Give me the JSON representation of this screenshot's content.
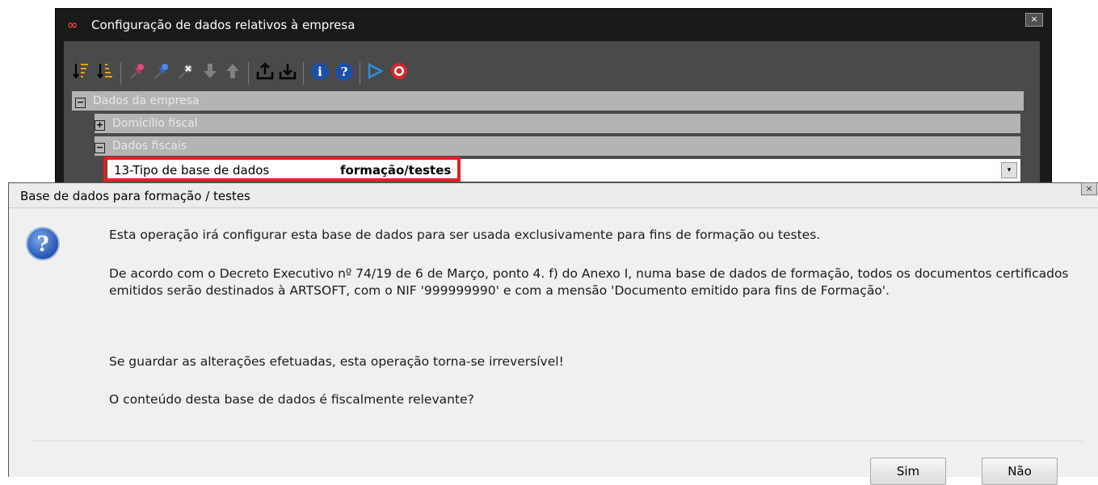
{
  "main_window": {
    "title": "Configuração de dados relativos à empresa",
    "close": "×",
    "tree": {
      "root": {
        "toggle": "−",
        "label": "Dados da empresa"
      },
      "child1": {
        "toggle": "+",
        "label": "Domicílio fiscal"
      },
      "child2": {
        "toggle": "−",
        "label": "Dados fiscais"
      },
      "property": {
        "label": "13-Tipo de base de dados",
        "value": "formação/testes",
        "dropdown": "▾"
      }
    }
  },
  "dialog": {
    "title": "Base de dados para formação / testes",
    "close": "×",
    "icon": "?",
    "message1": "Esta operação irá configurar esta base de dados para ser usada exclusivamente para fins de formação ou testes.",
    "message2": "De acordo com o Decreto Executivo nº 74/19 de 6 de Março, ponto 4. f) do Anexo I, numa base de dados de formação, todos os documentos certificados emitidos serão destinados à ARTSOFT, com o NIF '999999990' e com a mensão 'Documento emitido para fins de Formação'.",
    "message3": "Se guardar as alterações efetuadas, esta operação torna-se irreversível!",
    "message4": "O conteúdo desta base de dados é fiscalmente relevante?",
    "yes_label": "Sim",
    "no_label": "Não"
  },
  "toolbar_icons": [
    "sort-asc-icon",
    "sort-desc-icon",
    "pin-red-icon",
    "pin-blue-icon",
    "pin-remove-icon",
    "arrow-down-icon",
    "arrow-up-icon",
    "export-icon",
    "import-icon",
    "info-icon",
    "help-icon",
    "play-icon",
    "power-icon"
  ],
  "colors": {
    "highlight": "#e31e24",
    "info": "#1f4fa5",
    "play": "#2c8fe0",
    "power": "#d9282e"
  }
}
